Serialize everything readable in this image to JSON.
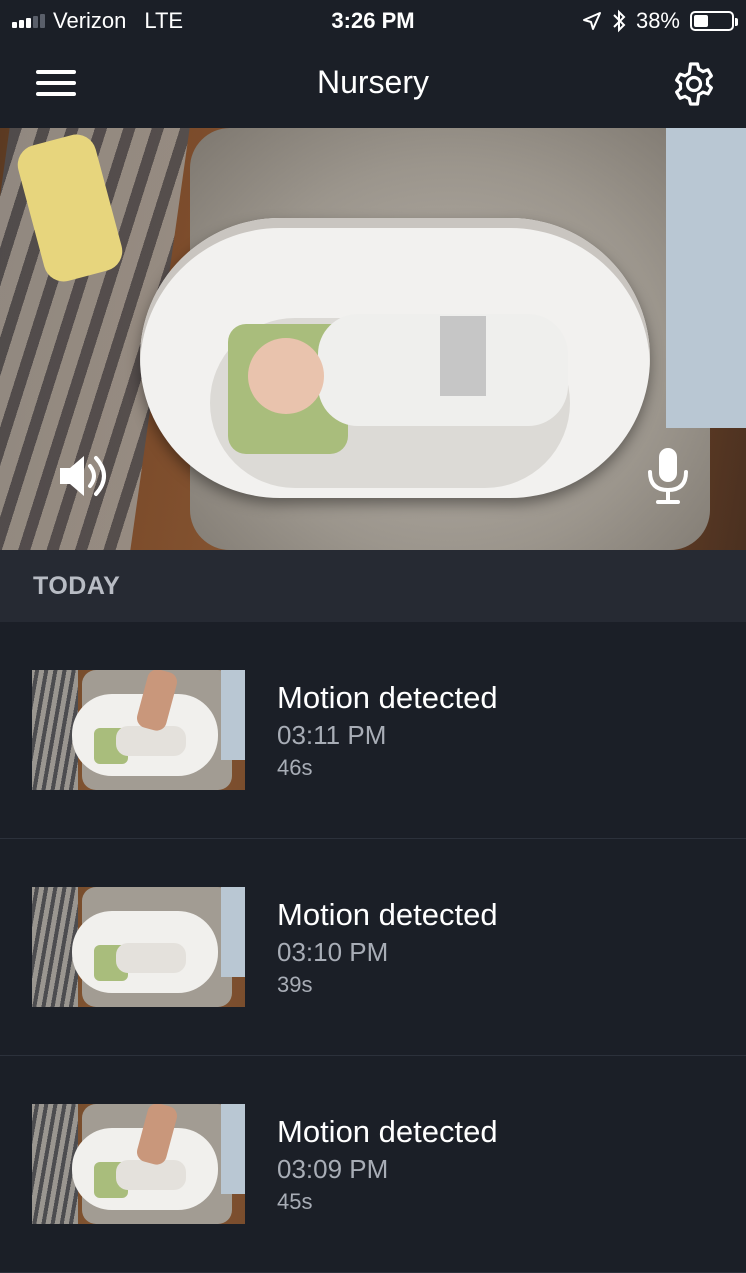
{
  "status_bar": {
    "carrier": "Verizon",
    "network": "LTE",
    "time": "3:26 PM",
    "battery_percent": "38%",
    "battery_level": 0.38,
    "signal_bars_filled": 3,
    "signal_bars_total": 5
  },
  "nav": {
    "title": "Nursery",
    "menu_icon": "hamburger-menu-icon",
    "settings_icon": "gear-icon"
  },
  "camera": {
    "speaker_icon": "speaker-icon",
    "mic_icon": "microphone-icon"
  },
  "events_section": {
    "label": "TODAY"
  },
  "events": [
    {
      "title": "Motion detected",
      "time": "03:11 PM",
      "duration": "46s"
    },
    {
      "title": "Motion detected",
      "time": "03:10 PM",
      "duration": "39s"
    },
    {
      "title": "Motion detected",
      "time": "03:09 PM",
      "duration": "45s"
    }
  ],
  "colors": {
    "background": "#1b1f27",
    "section_header": "#262a33",
    "secondary_text": "#a8adb6"
  }
}
